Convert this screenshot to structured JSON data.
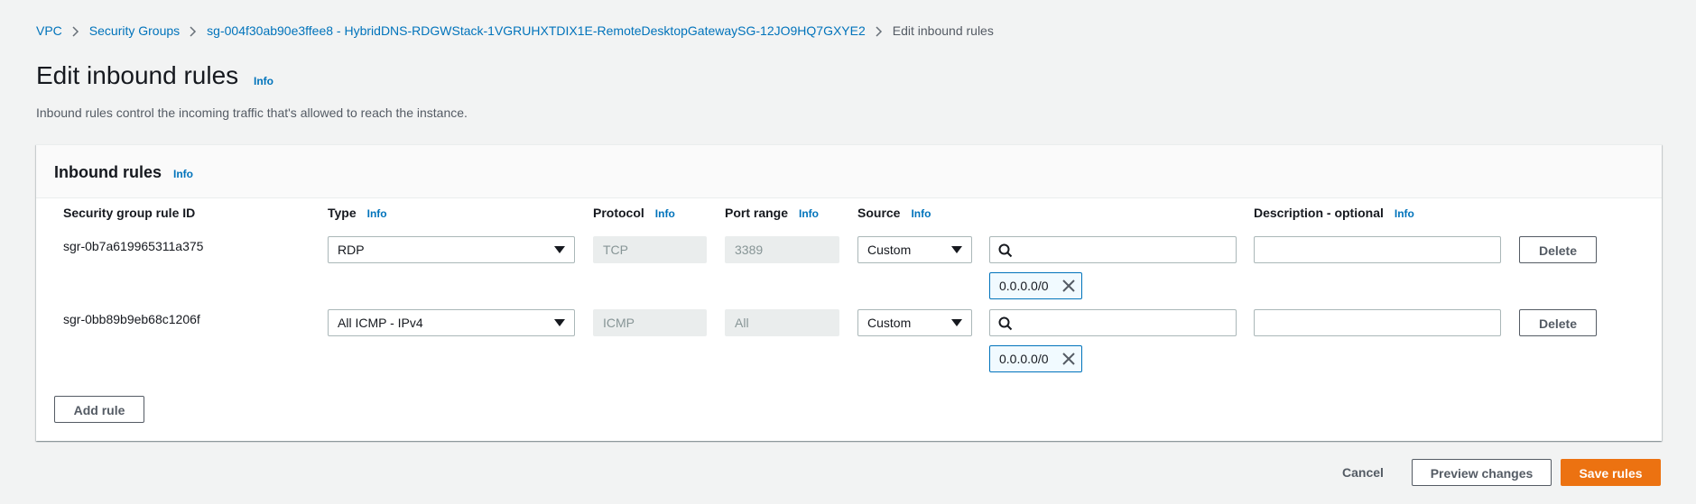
{
  "breadcrumb": {
    "items": [
      "VPC",
      "Security Groups",
      "sg-004f30ab90e3ffee8 - HybridDNS-RDGWStack-1VGRUHXTDIX1E-RemoteDesktopGatewaySG-12JO9HQ7GXYE2"
    ],
    "current": "Edit inbound rules"
  },
  "page": {
    "title": "Edit inbound rules",
    "info": "Info",
    "description": "Inbound rules control the incoming traffic that's allowed to reach the instance."
  },
  "panel": {
    "title": "Inbound rules",
    "info": "Info"
  },
  "columns": {
    "rule_id": "Security group rule ID",
    "type": "Type",
    "protocol": "Protocol",
    "port_range": "Port range",
    "source": "Source",
    "description": "Description - optional",
    "info": "Info"
  },
  "rules": [
    {
      "id": "sgr-0b7a619965311a375",
      "type": "RDP",
      "protocol": "TCP",
      "port_range": "3389",
      "source": "Custom",
      "search_value": "",
      "cidr": "0.0.0.0/0",
      "description": "",
      "delete_label": "Delete"
    },
    {
      "id": "sgr-0bb89b9eb68c1206f",
      "type": "All ICMP - IPv4",
      "protocol": "ICMP",
      "port_range": "All",
      "source": "Custom",
      "search_value": "",
      "cidr": "0.0.0.0/0",
      "description": "",
      "delete_label": "Delete"
    }
  ],
  "add_rule_label": "Add rule",
  "footer": {
    "cancel": "Cancel",
    "preview": "Preview changes",
    "save": "Save rules"
  },
  "colors": {
    "link": "#0073bb",
    "primary": "#ec7211",
    "background": "#f2f3f3"
  }
}
